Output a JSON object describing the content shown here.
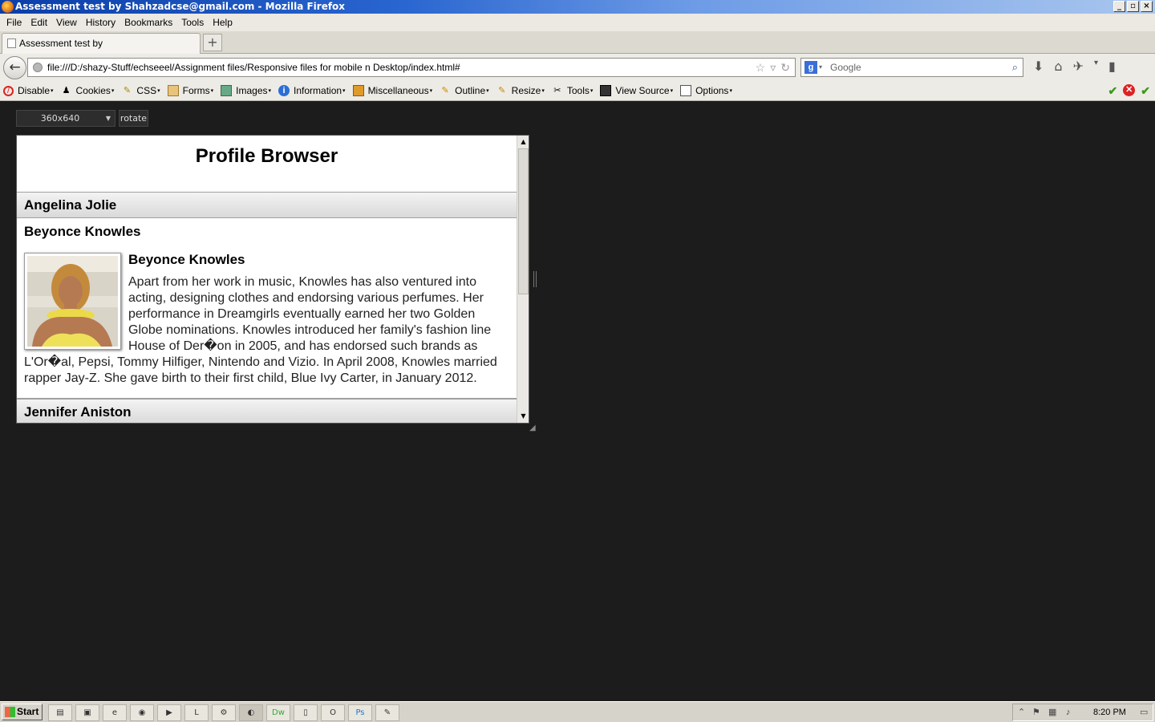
{
  "window": {
    "title": "Assessment test by Shahzadcse@gmail.com - Mozilla Firefox"
  },
  "menu": [
    "File",
    "Edit",
    "View",
    "History",
    "Bookmarks",
    "Tools",
    "Help"
  ],
  "tab": {
    "title": "Assessment test by Shahzadcse@gmail.com"
  },
  "navbar": {
    "url": "file:///D:/shazy-Stuff/echseeel/Assignment files/Responsive files for mobile n Desktop/index.html#",
    "search_placeholder": "Google"
  },
  "devtoolbar": [
    "Disable",
    "Cookies",
    "CSS",
    "Forms",
    "Images",
    "Information",
    "Miscellaneous",
    "Outline",
    "Resize",
    "Tools",
    "View Source",
    "Options"
  ],
  "responsive": {
    "size": "360x640",
    "rotate": "rotate"
  },
  "page": {
    "title": "Profile Browser",
    "profiles": [
      {
        "name": "Angelina Jolie"
      },
      {
        "name": "Beyonce Knowles",
        "detail_title": "Beyonce Knowles",
        "bio": "Apart from her work in music, Knowles has also ventured into acting, designing clothes and endorsing various perfumes. Her performance in Dreamgirls eventually earned her two Golden Globe nominations. Knowles introduced her family's fashion line House of Der�on in 2005, and has endorsed such brands as L'Or�al, Pepsi, Tommy Hilfiger, Nintendo and Vizio. In April 2008, Knowles married rapper Jay-Z. She gave birth to their first child, Blue Ivy Carter, in January 2012."
      },
      {
        "name": "Jennifer Aniston"
      }
    ]
  },
  "taskbar": {
    "start": "Start",
    "clock": "8:20 PM"
  }
}
